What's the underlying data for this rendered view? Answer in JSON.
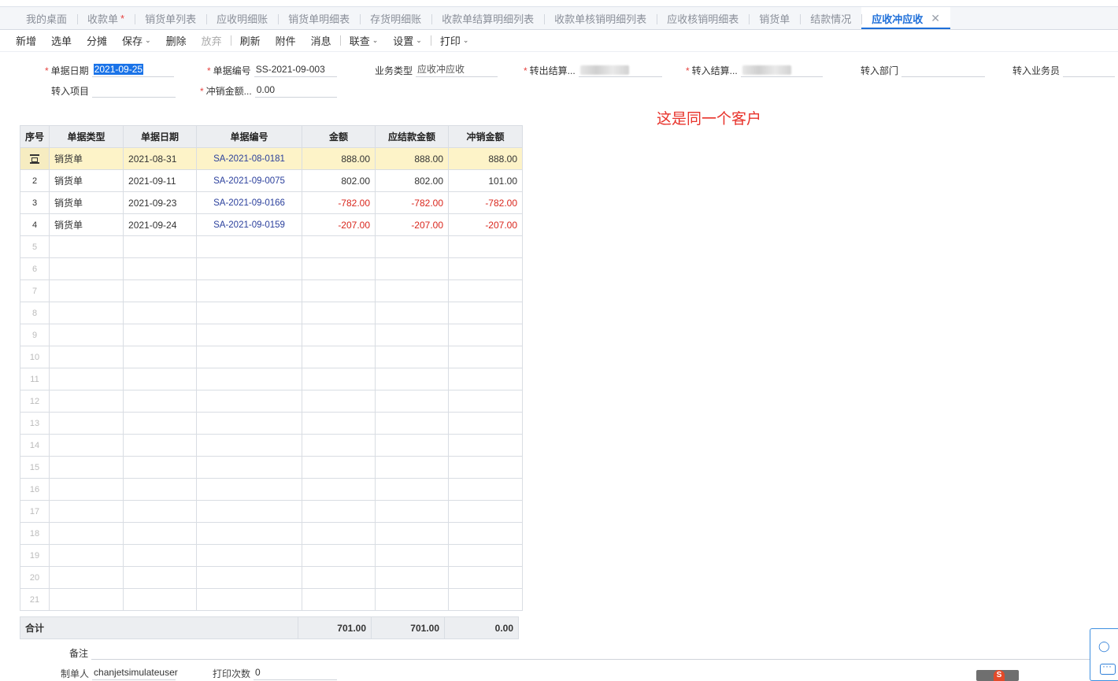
{
  "tabs": [
    {
      "label": "我的桌面",
      "required": false,
      "active": false
    },
    {
      "label": "收款单",
      "required": true,
      "active": false
    },
    {
      "label": "销货单列表",
      "required": false,
      "active": false
    },
    {
      "label": "应收明细账",
      "required": false,
      "active": false
    },
    {
      "label": "销货单明细表",
      "required": false,
      "active": false
    },
    {
      "label": "存货明细账",
      "required": false,
      "active": false
    },
    {
      "label": "收款单结算明细列表",
      "required": false,
      "active": false
    },
    {
      "label": "收款单核销明细列表",
      "required": false,
      "active": false
    },
    {
      "label": "应收核销明细表",
      "required": false,
      "active": false
    },
    {
      "label": "销货单",
      "required": false,
      "active": false
    },
    {
      "label": "结款情况",
      "required": false,
      "active": false
    },
    {
      "label": "应收冲应收",
      "required": false,
      "active": true
    }
  ],
  "tab_required_mark": "*",
  "tab_close_glyph": "✕",
  "toolbar": {
    "new": "新增",
    "select": "选单",
    "allocate": "分摊",
    "save": "保存",
    "delete": "删除",
    "discard": "放弃",
    "refresh": "刷新",
    "attachment": "附件",
    "message": "消息",
    "linked_query": "联查",
    "settings": "设置",
    "print": "打印"
  },
  "form": {
    "doc_date_label": "单据日期",
    "doc_date_value": "2021-09-25",
    "doc_no_label": "单据编号",
    "doc_no_value": "SS-2021-09-003",
    "biz_type_label": "业务类型",
    "biz_type_value": "应收冲应收",
    "transfer_out_label": "转出结算...",
    "transfer_in_label": "转入结算...",
    "transfer_in_dept_label": "转入部门",
    "transfer_in_salesman_label": "转入业务员",
    "transfer_in_project_label": "转入项目",
    "writeoff_amount_label": "冲销金额...",
    "writeoff_amount_value": "0.00",
    "required_mark": "*"
  },
  "annotation": "这是同一个客户",
  "grid": {
    "headers": [
      "序号",
      "单据类型",
      "单据日期",
      "单据编号",
      "金额",
      "应结款金额",
      "冲销金额"
    ],
    "rows": [
      {
        "seq": "",
        "type": "销货单",
        "date": "2021-08-31",
        "code": "SA-2021-08-0181",
        "amount": "888.00",
        "due": "888.00",
        "writeoff": "888.00",
        "negative": false,
        "current": true
      },
      {
        "seq": "2",
        "type": "销货单",
        "date": "2021-09-11",
        "code": "SA-2021-09-0075",
        "amount": "802.00",
        "due": "802.00",
        "writeoff": "101.00",
        "negative": false,
        "current": false
      },
      {
        "seq": "3",
        "type": "销货单",
        "date": "2021-09-23",
        "code": "SA-2021-09-0166",
        "amount": "-782.00",
        "due": "-782.00",
        "writeoff": "-782.00",
        "negative": true,
        "current": false
      },
      {
        "seq": "4",
        "type": "销货单",
        "date": "2021-09-24",
        "code": "SA-2021-09-0159",
        "amount": "-207.00",
        "due": "-207.00",
        "writeoff": "-207.00",
        "negative": true,
        "current": false
      }
    ],
    "empty_rows": [
      "5",
      "6",
      "7",
      "8",
      "9",
      "10",
      "11",
      "12",
      "13",
      "14",
      "15",
      "16",
      "17",
      "18",
      "19",
      "20",
      "21"
    ]
  },
  "total": {
    "label": "合计",
    "amount": "701.00",
    "due": "701.00",
    "writeoff": "0.00"
  },
  "remark_label": "备注",
  "footer": {
    "maker_label": "制单人",
    "maker_value": "chanjetsimulateuser",
    "print_count_label": "打印次数",
    "print_count_value": "0"
  },
  "icons": {
    "row-current": "row-marker-icon",
    "dropdown": "chevron-down-icon",
    "side-user": "user-icon",
    "side-chat": "chat-icon",
    "ime": "ime-status-icon"
  },
  "colors": {
    "accent": "#1e6fd9",
    "negative": "#d9261c",
    "required": "#e64340",
    "annotation": "#e8322a",
    "current_row": "#fdf3c8"
  }
}
